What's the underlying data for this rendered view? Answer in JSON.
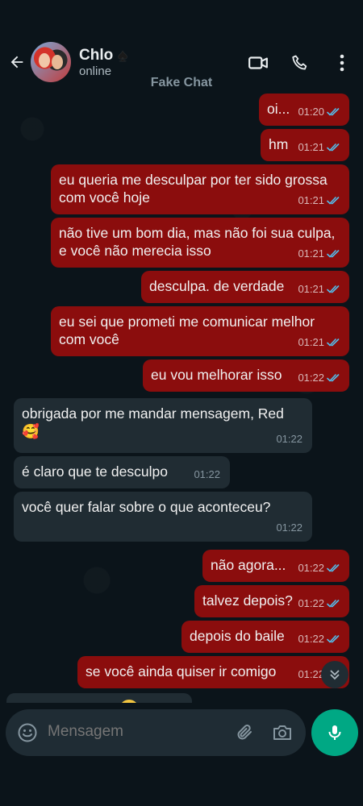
{
  "header": {
    "contact_name": "Chlo",
    "name_emoji": "♠",
    "status": "online",
    "chat_label": "Fake Chat"
  },
  "messages": [
    {
      "dir": "out",
      "text": "oi...",
      "time": "01:20",
      "read": true
    },
    {
      "dir": "out",
      "text": "hm",
      "time": "01:21",
      "read": true
    },
    {
      "dir": "out",
      "text": "eu queria me desculpar por ter sido grossa com você hoje",
      "time": "01:21",
      "read": true
    },
    {
      "dir": "out",
      "text": "não tive um bom dia, mas não foi sua culpa, e você não merecia isso",
      "time": "01:21",
      "read": true
    },
    {
      "dir": "out",
      "text": "desculpa. de verdade",
      "time": "01:21",
      "read": true
    },
    {
      "dir": "out",
      "text": "eu sei que prometi me comunicar melhor com você",
      "time": "01:21",
      "read": true
    },
    {
      "dir": "out",
      "text": "eu vou melhorar isso",
      "time": "01:22",
      "read": true
    },
    {
      "dir": "in",
      "text": "obrigada por me mandar mensagem, Red 🥰",
      "time": "01:22"
    },
    {
      "dir": "in",
      "text": "é claro que te desculpo",
      "time": "01:22"
    },
    {
      "dir": "in",
      "text": "você quer falar sobre o que aconteceu?",
      "time": "01:22"
    },
    {
      "dir": "out",
      "text": "não agora...",
      "time": "01:22",
      "read": true
    },
    {
      "dir": "out",
      "text": "talvez depois?",
      "time": "01:22",
      "read": true
    },
    {
      "dir": "out",
      "text": "depois do baile",
      "time": "01:22",
      "read": true
    },
    {
      "dir": "out",
      "text": "se você ainda quiser ir comigo",
      "time": "01:22",
      "read": true
    }
  ],
  "composer": {
    "placeholder": "Mensagem"
  },
  "colors": {
    "outgoing_bubble": "#8b0d0d",
    "incoming_bubble": "#202c33",
    "read_ticks": "#53bdeb",
    "mic_button": "#00a884"
  },
  "icons": [
    "back-arrow-icon",
    "video-call-icon",
    "phone-icon",
    "more-options-icon",
    "emoji-icon",
    "attach-icon",
    "camera-icon",
    "mic-icon",
    "scroll-down-icon"
  ]
}
